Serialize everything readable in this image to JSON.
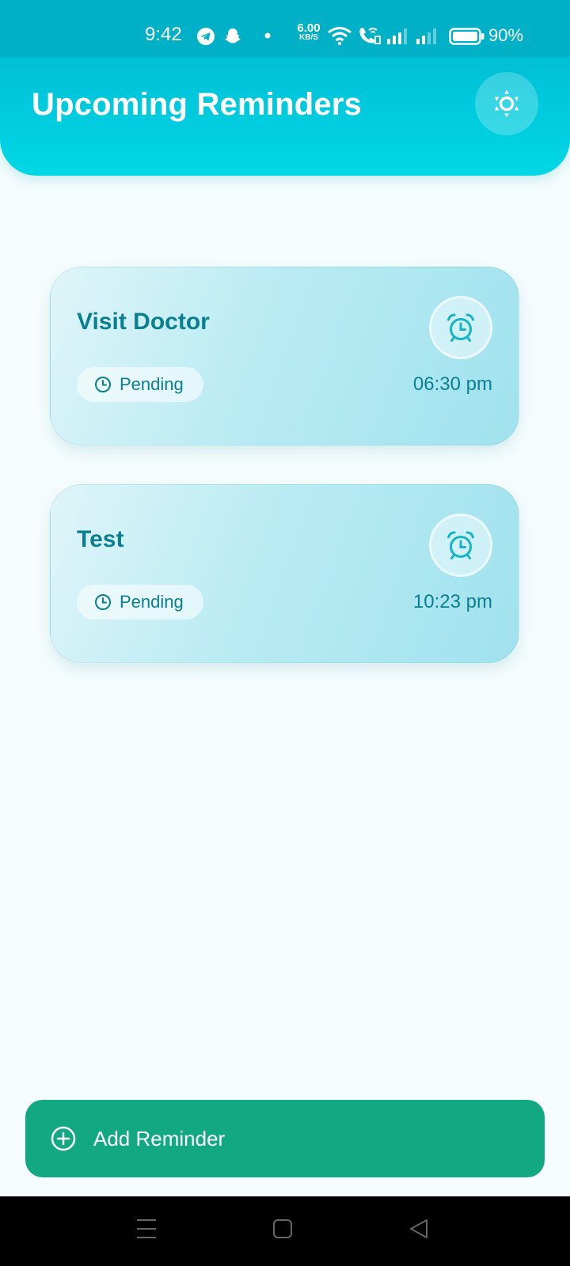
{
  "status_bar": {
    "time": "9:42",
    "net_speed_value": "6.00",
    "net_speed_unit": "KB/S",
    "battery": "90%",
    "icons": [
      "telegram-icon",
      "snapchat-icon",
      "dot-icon",
      "wifi-icon",
      "wifi-call-icon",
      "signal-icon",
      "signal-icon",
      "battery-icon"
    ]
  },
  "header": {
    "title": "Upcoming Reminders",
    "settings_icon": "brightness-icon"
  },
  "reminders": [
    {
      "title": "Visit Doctor",
      "status": "Pending",
      "time": "06:30 pm",
      "icon": "alarm-clock-icon"
    },
    {
      "title": "Test",
      "status": "Pending",
      "time": "10:23 pm",
      "icon": "alarm-clock-icon"
    }
  ],
  "add_button": {
    "label": "Add Reminder",
    "icon": "plus-circle-icon"
  },
  "nav_bar": {
    "items": [
      "menu-icon",
      "home-icon",
      "back-icon"
    ]
  },
  "colors": {
    "header": "#00c8dc",
    "accent_text": "#0a7f90",
    "add_button": "#12a982",
    "background": "#f5fcfd"
  }
}
